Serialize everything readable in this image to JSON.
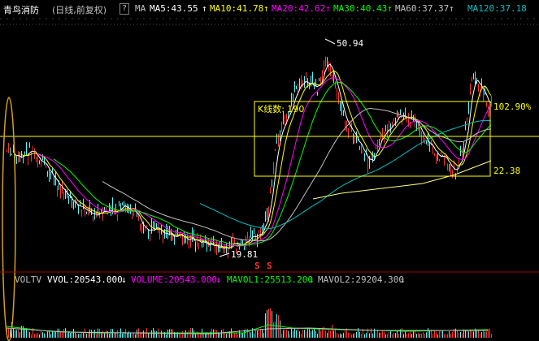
{
  "stock_name": "青鸟消防",
  "period_label": "(日线,前复权)",
  "help_icon": "?",
  "ma_label": "MA",
  "ma_items": [
    {
      "label": "MA5:43.55",
      "color": "#ffffff",
      "arrow": "↑"
    },
    {
      "label": "MA10:41.78",
      "color": "#ffff00",
      "arrow": "↑"
    },
    {
      "label": "MA20:42.62",
      "color": "#ff00ff",
      "arrow": "↑"
    },
    {
      "label": "MA30:40.43",
      "color": "#00ff00",
      "arrow": "↑"
    },
    {
      "label": "MA60:37.37",
      "color": "#c0c0c0",
      "arrow": "↑"
    },
    {
      "label": "MA120:37.18",
      "color": "#00c0c0",
      "arrow": "↑"
    }
  ],
  "price_annotations": {
    "high": "50.94",
    "low": "19.81",
    "box_label": "K线数: 190",
    "box_pct": "102.90%",
    "box_low": "22.38",
    "signal_marks": [
      "S",
      "S"
    ]
  },
  "volume": {
    "indicator": "VOLTV",
    "vvol": "VVOL:20543.000",
    "volume": "VOLUME:20543.000",
    "mavol1": "MAVOL1:25513.200",
    "mavol2": "MAVOL2:29204.300",
    "arrow": "↓"
  },
  "colors": {
    "up": "#ff3232",
    "down": "#54fcfc",
    "box": "#ffff00",
    "ma5": "#ffffff",
    "ma10": "#ffff00",
    "ma20": "#ff00ff",
    "ma30": "#00ff00",
    "ma60": "#c0c0c0",
    "ma120": "#00c0c0"
  }
}
